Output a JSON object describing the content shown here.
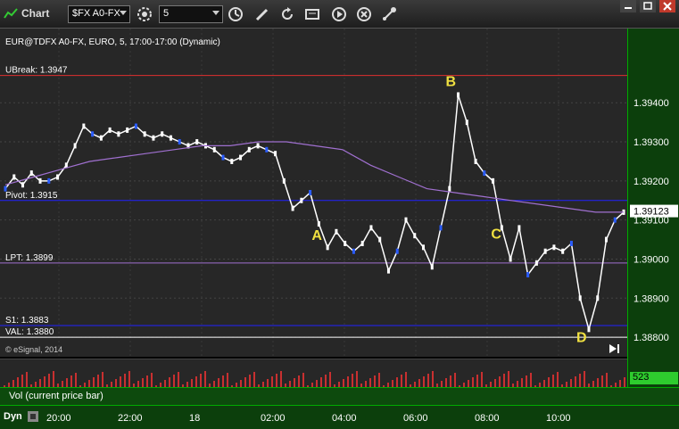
{
  "toolbar": {
    "app_title": "Chart",
    "symbol": "$FX A0-FX",
    "interval": "5"
  },
  "chart": {
    "header": "EUR@TDFX A0-FX, EURO, 5, 17:00-17:00 (Dynamic)",
    "copyright": "© eSignal, 2014",
    "levels": [
      {
        "label": "UBreak: 1.3947",
        "value": 1.3947,
        "color": "#e03030"
      },
      {
        "label": "Pivot: 1.3915",
        "value": 1.3915,
        "color": "#2020ff"
      },
      {
        "label": "LPT: 1.3899",
        "value": 1.3899,
        "color": "#a070d0"
      },
      {
        "label": "S1: 1.3883",
        "value": 1.3883,
        "color": "#2020ff"
      },
      {
        "label": "VAL: 1.3880",
        "value": 1.388,
        "color": "#ffffff"
      }
    ],
    "annotations": [
      "A",
      "B",
      "C",
      "D"
    ],
    "current_price": "1.39123",
    "volume_label": "Vol (current price bar)",
    "volume_value": "523",
    "dyn_label": "Dyn"
  },
  "chart_data": {
    "type": "line",
    "y_ticks": [
      "1.39400",
      "1.39300",
      "1.39200",
      "1.39100",
      "1.39000",
      "1.38900",
      "1.38800"
    ],
    "ylim": [
      1.3875,
      1.3959
    ],
    "x_ticks": [
      "20:00",
      "22:00",
      "18",
      "02:00",
      "04:00",
      "06:00",
      "08:00",
      "10:00"
    ],
    "series": [
      {
        "values": [
          1.3918,
          1.3921,
          1.3919,
          1.3922,
          1.392,
          1.392,
          1.3921,
          1.3924,
          1.3929,
          1.3934,
          1.3932,
          1.3931,
          1.3933,
          1.3932,
          1.3933,
          1.3934,
          1.3932,
          1.3931,
          1.3932,
          1.3931,
          1.393,
          1.3929,
          1.393,
          1.3929,
          1.3928,
          1.3926,
          1.3925,
          1.3926,
          1.3928,
          1.3929,
          1.3928,
          1.3927,
          1.392,
          1.3913,
          1.3915,
          1.3917,
          1.3909,
          1.3903,
          1.3907,
          1.3904,
          1.3902,
          1.3904,
          1.3908,
          1.3905,
          1.3897,
          1.3902,
          1.391,
          1.3906,
          1.3903,
          1.3898,
          1.3908,
          1.3918,
          1.3942,
          1.3935,
          1.3925,
          1.3922,
          1.392,
          1.3908,
          1.39,
          1.3908,
          1.3896,
          1.3899,
          1.3902,
          1.3903,
          1.3902,
          1.3904,
          1.389,
          1.3882,
          1.389,
          1.3905,
          1.391,
          1.3912
        ]
      },
      {
        "values": [
          1.3919,
          1.3921,
          1.3923,
          1.3925,
          1.3926,
          1.3927,
          1.3928,
          1.3929,
          1.3929,
          1.393,
          1.393,
          1.3929,
          1.3928,
          1.3924,
          1.3921,
          1.3918,
          1.3917,
          1.3916,
          1.3915,
          1.3914,
          1.3913,
          1.3912,
          1.3912
        ]
      }
    ]
  }
}
